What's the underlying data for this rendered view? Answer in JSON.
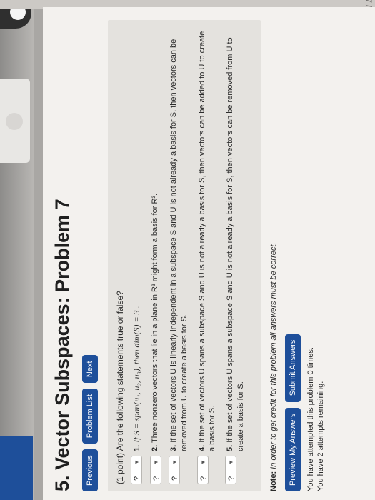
{
  "page_title": "5. Vector Subspaces: Problem 7",
  "nav": {
    "previous": "Previous",
    "problem_list": "Problem List",
    "next": "Next"
  },
  "prompt": "(1 point) Are the following statements true or false?",
  "questions": [
    {
      "select": "?",
      "number": "1.",
      "text": "If S = span(u₁, u₂, u₃), then dim(S) = 3 ."
    },
    {
      "select": "?",
      "number": "2.",
      "text": "Three nonzero vectors that lie in a plane in R³ might form a basis for R³."
    },
    {
      "select": "?",
      "number": "3.",
      "text": "If the set of vectors U is linearly independent in a subspace S and U is not already a basis for S, then vectors can be removed from U to create a basis for S."
    },
    {
      "select": "?",
      "number": "4.",
      "text": "If the set of vectors U spans a subspace S and U is not already a basis for S, then vectors can be added to U to create a basis for S."
    },
    {
      "select": "?",
      "number": "5.",
      "text": "If the set of vectors U spans a subspace S and U is not already a basis for S, then vectors can be removed from U to create a basis for S."
    }
  ],
  "note": {
    "label": "Note:",
    "text": "In order to get credit for this problem all answers must be correct."
  },
  "buttons": {
    "preview": "Preview My Answers",
    "submit": "Submit Answers"
  },
  "messages": {
    "attempted": "You have attempted this problem 0 times.",
    "remaining": "You have 2 attempts remaining."
  },
  "top_fragment": "...ubspaces 7 /",
  "colors": {
    "accent": "#1e4f9a",
    "page_bg": "#f3f1ee",
    "panel_bg": "#e4e2de"
  }
}
